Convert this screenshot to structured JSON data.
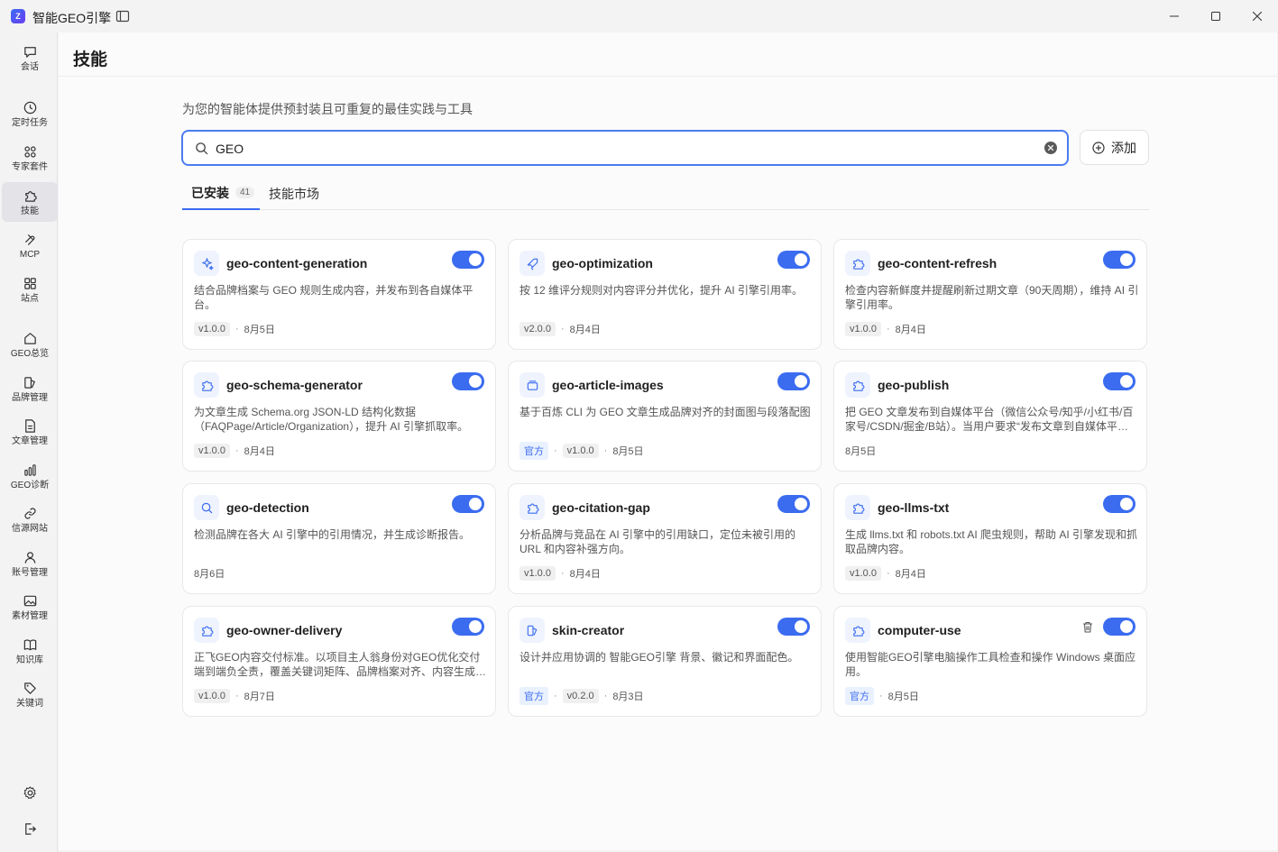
{
  "window": {
    "title": "智能GEO引擎",
    "logo": "Z"
  },
  "rail": {
    "items": [
      {
        "key": "chat",
        "label": "会话",
        "icon": "chat-icon"
      },
      {
        "key": "tasks",
        "label": "定时任务",
        "icon": "clock-icon"
      },
      {
        "key": "experts",
        "label": "专家套件",
        "icon": "grid-icon"
      },
      {
        "key": "skills",
        "label": "技能",
        "icon": "puzzle-icon",
        "active": true
      },
      {
        "key": "mcp",
        "label": "MCP",
        "icon": "mcp-icon"
      },
      {
        "key": "sites",
        "label": "站点",
        "icon": "sites-icon"
      },
      {
        "key": "geo",
        "label": "GEO总览",
        "icon": "home-icon"
      },
      {
        "key": "brand",
        "label": "品牌管理",
        "icon": "brand-icon"
      },
      {
        "key": "articles",
        "label": "文章管理",
        "icon": "document-icon"
      },
      {
        "key": "diagnose",
        "label": "GEO诊断",
        "icon": "bar-chart-icon"
      },
      {
        "key": "sources",
        "label": "信源网站",
        "icon": "link-icon"
      },
      {
        "key": "accounts",
        "label": "账号管理",
        "icon": "user-icon"
      },
      {
        "key": "assets",
        "label": "素材管理",
        "icon": "image-icon"
      },
      {
        "key": "knowledge",
        "label": "知识库",
        "icon": "book-icon"
      },
      {
        "key": "keywords",
        "label": "关键词",
        "icon": "tag-icon"
      }
    ]
  },
  "page": {
    "title": "技能",
    "subtitle": "为您的智能体提供预封装且可重复的最佳实践与工具",
    "search": {
      "value": "GEO"
    },
    "add_label": "添加",
    "tabs": {
      "installed": "已安装",
      "installed_count": "41",
      "market": "技能市场"
    }
  },
  "skills": [
    {
      "name": "geo-content-generation",
      "icon": "sparkle-icon",
      "desc": "结合品牌档案与 GEO 规则生成内容，并发布到各自媒体平台。",
      "official": false,
      "version": "v1.0.0",
      "date": "8月5日",
      "enabled": true
    },
    {
      "name": "geo-optimization",
      "icon": "rocket-icon",
      "desc": "按 12 维评分规则对内容评分并优化，提升 AI 引擎引用率。",
      "official": false,
      "version": "v2.0.0",
      "date": "8月4日",
      "enabled": true
    },
    {
      "name": "geo-content-refresh",
      "icon": "puzzle-icon",
      "desc": "检查内容新鲜度并提醒刷新过期文章（90天周期），维持 AI 引擎引用率。",
      "official": false,
      "version": "v1.0.0",
      "date": "8月4日",
      "enabled": true
    },
    {
      "name": "geo-schema-generator",
      "icon": "puzzle-icon",
      "desc": "为文章生成 Schema.org JSON-LD 结构化数据（FAQPage/Article/Organization），提升 AI 引擎抓取率。",
      "official": false,
      "version": "v1.0.0",
      "date": "8月4日",
      "enabled": true
    },
    {
      "name": "geo-article-images",
      "icon": "image-stack-icon",
      "desc": "基于百炼 CLI 为 GEO 文章生成品牌对齐的封面图与段落配图",
      "official": true,
      "official_label": "官方",
      "version": "v1.0.0",
      "date": "8月5日",
      "enabled": true
    },
    {
      "name": "geo-publish",
      "icon": "puzzle-icon",
      "desc": "把 GEO 文章发布到自媒体平台（微信公众号/知乎/小红书/百家号/CSDN/掘金/B站）。当用户要求“发布文章到自媒体平台”时使用。",
      "official": false,
      "version": "",
      "date": "8月5日",
      "enabled": true
    },
    {
      "name": "geo-detection",
      "icon": "search-icon",
      "desc": "检测品牌在各大 AI 引擎中的引用情况，并生成诊断报告。",
      "official": false,
      "version": "",
      "date": "8月6日",
      "enabled": true
    },
    {
      "name": "geo-citation-gap",
      "icon": "puzzle-icon",
      "desc": "分析品牌与竞品在 AI 引擎中的引用缺口，定位未被引用的 URL 和内容补强方向。",
      "official": false,
      "version": "v1.0.0",
      "date": "8月4日",
      "enabled": true
    },
    {
      "name": "geo-llms-txt",
      "icon": "puzzle-icon",
      "desc": "生成 llms.txt 和 robots.txt AI 爬虫规则，帮助 AI 引擎发现和抓取品牌内容。",
      "official": false,
      "version": "v1.0.0",
      "date": "8月4日",
      "enabled": true
    },
    {
      "name": "geo-owner-delivery",
      "icon": "puzzle-icon",
      "desc": "正飞GEO内容交付标准。以项目主人翁身份对GEO优化交付端到端负全责，覆盖关键词矩阵、品牌档案对齐、内容生成、发布与监测。",
      "official": false,
      "version": "v1.0.0",
      "date": "8月7日",
      "enabled": true
    },
    {
      "name": "skin-creator",
      "icon": "palette-icon",
      "desc": "设计并应用协调的 智能GEO引擎 背景、徽记和界面配色。",
      "official": true,
      "official_label": "官方",
      "version": "v0.2.0",
      "date": "8月3日",
      "enabled": true
    },
    {
      "name": "computer-use",
      "icon": "puzzle-icon",
      "desc": "使用智能GEO引擎电脑操作工具检查和操作 Windows 桌面应用。",
      "official": true,
      "official_label": "官方",
      "version": "",
      "date": "8月5日",
      "enabled": true,
      "deletable": true
    }
  ],
  "colors": {
    "accent": "#3b6cf0",
    "card_border": "#e8e8e8"
  }
}
